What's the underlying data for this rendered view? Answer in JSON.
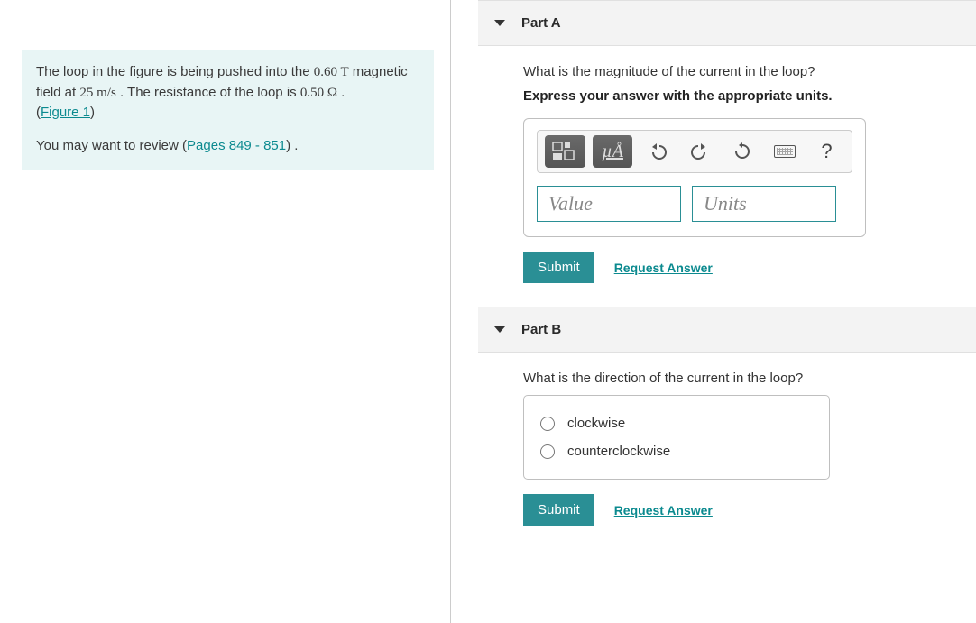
{
  "problem": {
    "text_before_b": "The loop in the figure is being pushed into the ",
    "b_value": "0.60 T",
    "text_mid1": " magnetic field at ",
    "v_value": "25 m/s",
    "text_mid2": " . The resistance of the loop is ",
    "r_value": "0.50 Ω",
    "text_end": " .",
    "figure_label": "Figure 1",
    "review_prefix": "You may want to review (",
    "review_link": "Pages 849 - 851",
    "review_suffix": ") ."
  },
  "partA": {
    "header": "Part A",
    "question": "What is the magnitude of the current in the loop?",
    "instruction": "Express your answer with the appropriate units.",
    "value_placeholder": "Value",
    "units_placeholder": "Units",
    "mu_label": "µÅ",
    "help_label": "?",
    "submit": "Submit",
    "request": "Request Answer"
  },
  "partB": {
    "header": "Part B",
    "question": "What is the direction of the current in the loop?",
    "options": [
      "clockwise",
      "counterclockwise"
    ],
    "submit": "Submit",
    "request": "Request Answer"
  }
}
